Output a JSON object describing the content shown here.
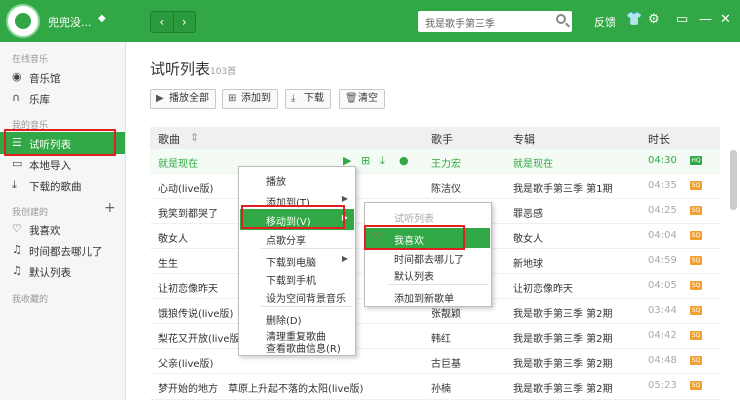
{
  "topbar": {
    "username": "兜兜没...",
    "search_placeholder": "我是歌手第三季",
    "feedback": "反馈",
    "colors": {
      "brand": "#31a845"
    }
  },
  "sidebar": {
    "online_head": "在线音乐",
    "music_hall": "音乐馆",
    "library": "乐库",
    "my_music_head": "我的音乐",
    "trial_list": "试听列表",
    "local_import": "本地导入",
    "downloaded": "下载的歌曲",
    "created_head": "我创建的",
    "favorites": "我喜欢",
    "where_time_went": "时间都去哪儿了",
    "default_list": "默认列表",
    "collected_head": "我收藏的"
  },
  "main": {
    "title": "试听列表",
    "count": "103首",
    "buttons": {
      "play_all": "播放全部",
      "add_to": "添加到",
      "download": "下载",
      "clear": "清空"
    },
    "columns": {
      "song": "歌曲",
      "singer": "歌手",
      "album": "专辑",
      "duration": "时长"
    },
    "rows": [
      {
        "song": "就是现在",
        "singer": "王力宏",
        "album": "就是现在",
        "duration": "04:30",
        "quality": "HQ"
      },
      {
        "song": "心动(live版)",
        "singer": "陈洁仪",
        "album": "我是歌手第三季 第1期",
        "duration": "04:35",
        "quality": "SQ"
      },
      {
        "song": "我笑到都哭了",
        "singer": "",
        "album": "罪恶感",
        "duration": "04:25",
        "quality": "SQ"
      },
      {
        "song": "敬女人",
        "singer": "",
        "album": "敬女人",
        "duration": "04:04",
        "quality": "SQ"
      },
      {
        "song": "生生",
        "singer": "",
        "album": "新地球",
        "duration": "04:59",
        "quality": "SQ"
      },
      {
        "song": "让初恋像昨天",
        "singer": "",
        "album": "让初恋像昨天",
        "duration": "04:05",
        "quality": "SQ"
      },
      {
        "song": "饿狼传说(live版)",
        "singer": "张靓颖",
        "album": "我是歌手第三季 第2期",
        "duration": "03:44",
        "quality": "SQ"
      },
      {
        "song": "梨花又开放(live版)",
        "singer": "韩红",
        "album": "我是歌手第三季 第2期",
        "duration": "04:42",
        "quality": "SQ"
      },
      {
        "song": "父亲(live版)",
        "singer": "古巨基",
        "album": "我是歌手第三季 第2期",
        "duration": "04:48",
        "quality": "SQ"
      },
      {
        "song": "梦开始的地方　草原上升起不落的太阳(live版)",
        "singer": "孙楠",
        "album": "我是歌手第三季 第2期",
        "duration": "05:23",
        "quality": "SQ"
      }
    ]
  },
  "context_menu": {
    "items": [
      "播放",
      "添加到(T)",
      "移动到(V)",
      "点歌分享",
      "下载到电脑",
      "下载到手机",
      "设为空间背景音乐",
      "删除(D)",
      "清理重复歌曲",
      "查看歌曲信息(R)"
    ]
  },
  "submenu": {
    "items": [
      "试听列表",
      "我喜欢",
      "时间都去哪儿了",
      "默认列表",
      "添加到新歌单"
    ]
  }
}
